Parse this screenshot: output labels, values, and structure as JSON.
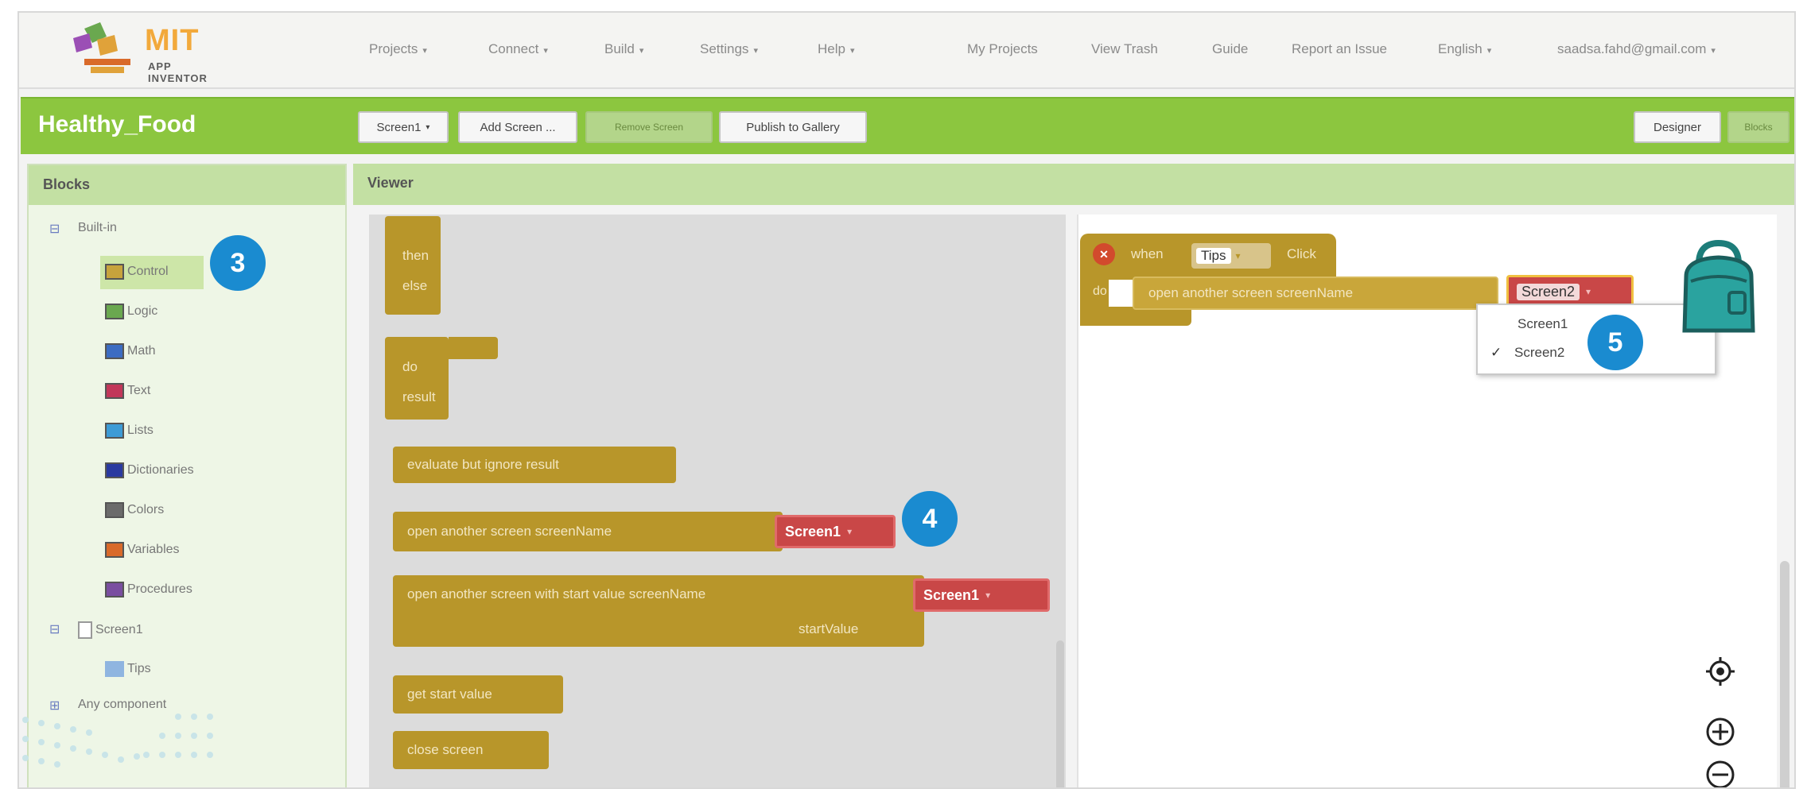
{
  "brand": {
    "name": "MIT",
    "subtitle": "APP INVENTOR"
  },
  "topnav": {
    "menus": [
      "Projects",
      "Connect",
      "Build",
      "Settings",
      "Help"
    ],
    "links": [
      "My Projects",
      "View Trash",
      "Guide",
      "Report an Issue",
      "English",
      "saadsa.fahd@gmail.com"
    ]
  },
  "projectbar": {
    "project_name": "Healthy_Food",
    "screen_select": "Screen1",
    "add_screen": "Add Screen ...",
    "remove_screen": "Remove Screen",
    "publish": "Publish to Gallery",
    "designer": "Designer",
    "blocks": "Blocks"
  },
  "blocks_panel": {
    "title": "Blocks",
    "builtin_label": "Built-in",
    "builtin_items": [
      {
        "label": "Control",
        "color": "#c7a33c"
      },
      {
        "label": "Logic",
        "color": "#6aa84f"
      },
      {
        "label": "Math",
        "color": "#3c6cc2"
      },
      {
        "label": "Text",
        "color": "#c2375a"
      },
      {
        "label": "Lists",
        "color": "#3d9bd6"
      },
      {
        "label": "Dictionaries",
        "color": "#2a3aa0"
      },
      {
        "label": "Colors",
        "color": "#6b6b6b"
      },
      {
        "label": "Variables",
        "color": "#d96a2a"
      },
      {
        "label": "Procedures",
        "color": "#7a4ea0"
      }
    ],
    "screen_label": "Screen1",
    "screen_child": "Tips",
    "any_component": "Any component"
  },
  "viewer": {
    "title": "Viewer"
  },
  "flyout": {
    "then": "then",
    "else": "else",
    "do": "do",
    "result": "result",
    "evaluate": "evaluate but ignore result",
    "open_screen": "open another screen  screenName",
    "open_screen_value": "Screen1",
    "open_screen_start": "open another screen with start value  screenName",
    "open_screen_start_value": "Screen1",
    "start_value_label": "startValue",
    "get_start_value": "get start value",
    "close_screen": "close screen"
  },
  "workspace": {
    "when": "when",
    "component": "Tips",
    "event": "Click",
    "do": "do",
    "call": "open another screen  screenName",
    "screen_value": "Screen2",
    "popup_options": [
      {
        "label": "Screen1",
        "checked": false
      },
      {
        "label": "Screen2",
        "checked": true
      }
    ],
    "checkmark": "✓"
  },
  "callouts": [
    "3",
    "4",
    "5"
  ],
  "colors": {
    "brand_green": "#8cc63f",
    "control_block": "#b8962a",
    "screen_dropdown": "#c94747",
    "callout": "#1a8bd0"
  }
}
